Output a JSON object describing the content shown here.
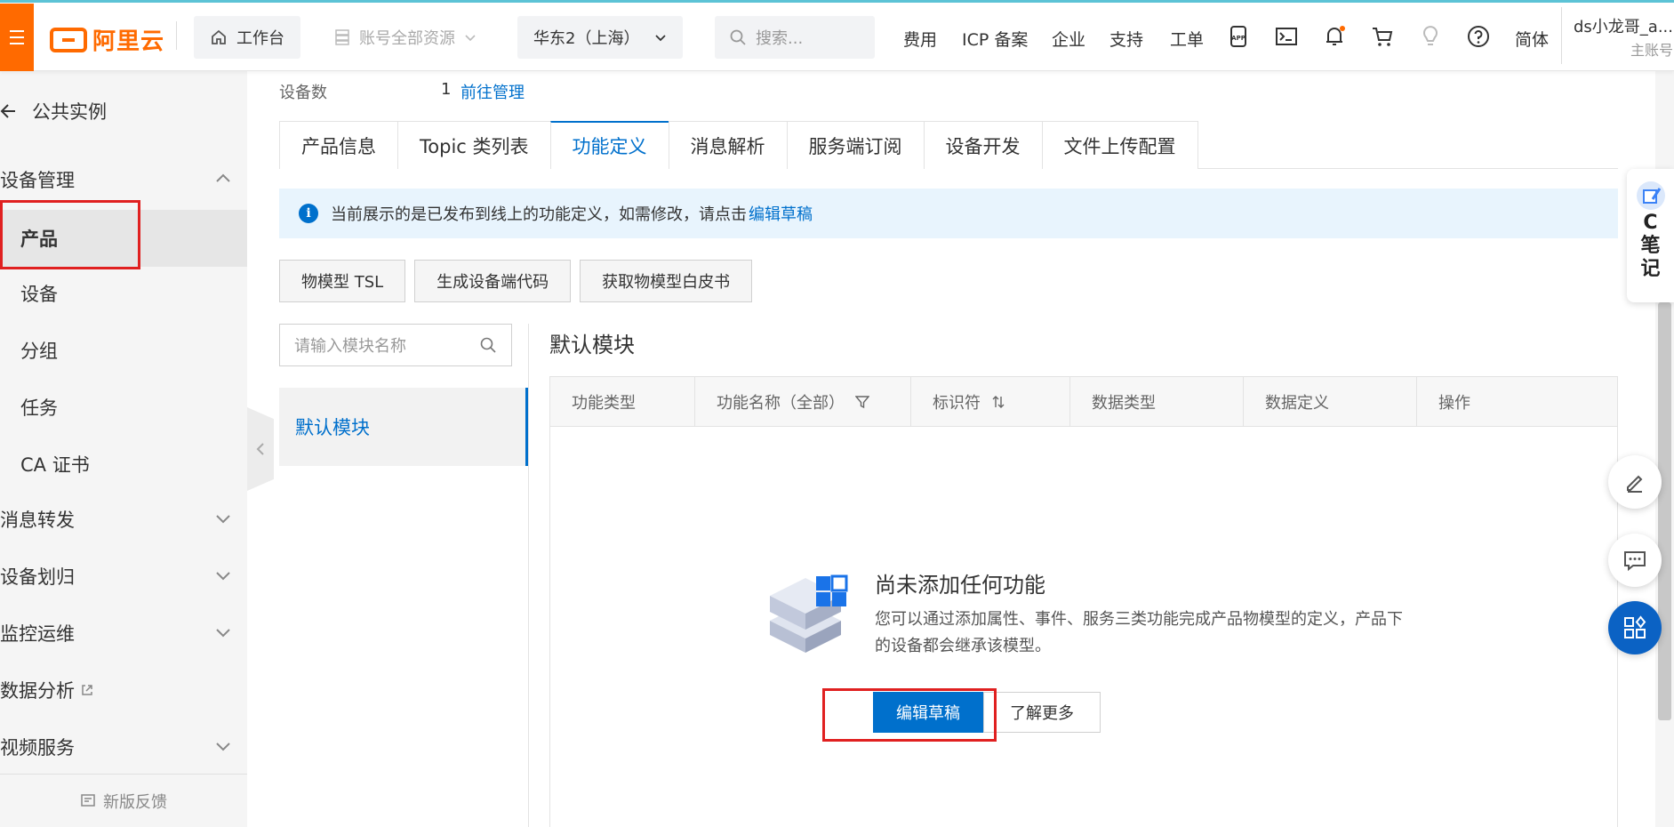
{
  "topbar": {
    "brand": "阿里云",
    "workbench": "工作台",
    "account_resources": "账号全部资源",
    "region": "华东2（上海）",
    "search_placeholder": "搜索...",
    "nav": [
      "费用",
      "ICP 备案",
      "企业",
      "支持",
      "工单"
    ],
    "language": "简体",
    "user_name": "ds小龙哥_a...",
    "user_role": "主账号"
  },
  "sidebar": {
    "back_label": "公共实例",
    "items": [
      {
        "label": "设备管理",
        "type": "group",
        "expanded": true
      },
      {
        "label": "产品",
        "type": "child",
        "active": true
      },
      {
        "label": "设备",
        "type": "child"
      },
      {
        "label": "分组",
        "type": "child"
      },
      {
        "label": "任务",
        "type": "child"
      },
      {
        "label": "CA 证书",
        "type": "child"
      },
      {
        "label": "消息转发",
        "type": "group"
      },
      {
        "label": "设备划归",
        "type": "group"
      },
      {
        "label": "监控运维",
        "type": "group"
      },
      {
        "label": "数据分析",
        "type": "group-link"
      },
      {
        "label": "视频服务",
        "type": "group"
      }
    ],
    "feedback": "新版反馈"
  },
  "main": {
    "device_count_label": "设备数",
    "device_count_value": "1",
    "device_count_link": "前往管理",
    "tabs": [
      "产品信息",
      "Topic 类列表",
      "功能定义",
      "消息解析",
      "服务端订阅",
      "设备开发",
      "文件上传配置"
    ],
    "active_tab": "功能定义",
    "notice_text": "当前展示的是已发布到线上的功能定义，如需修改，请点击",
    "notice_link": "编辑草稿",
    "actions": [
      "物模型 TSL",
      "生成设备端代码",
      "获取物模型白皮书"
    ],
    "module_search_placeholder": "请输入模块名称",
    "module_item": "默认模块",
    "module_title": "默认模块",
    "table_headers": [
      "功能类型",
      "功能名称（全部）",
      "标识符",
      "数据类型",
      "数据定义",
      "操作"
    ],
    "empty_title": "尚未添加任何功能",
    "empty_desc": "您可以通过添加属性、事件、服务三类功能完成产品物模型的定义，产品下的设备都会继承该模型。",
    "primary_button": "编辑草稿",
    "secondary_button": "了解更多"
  },
  "floating": {
    "note_label": "C笔记"
  },
  "colors": {
    "brand": "#ff6a00",
    "primary": "#0070cc",
    "highlight": "#e02020"
  }
}
